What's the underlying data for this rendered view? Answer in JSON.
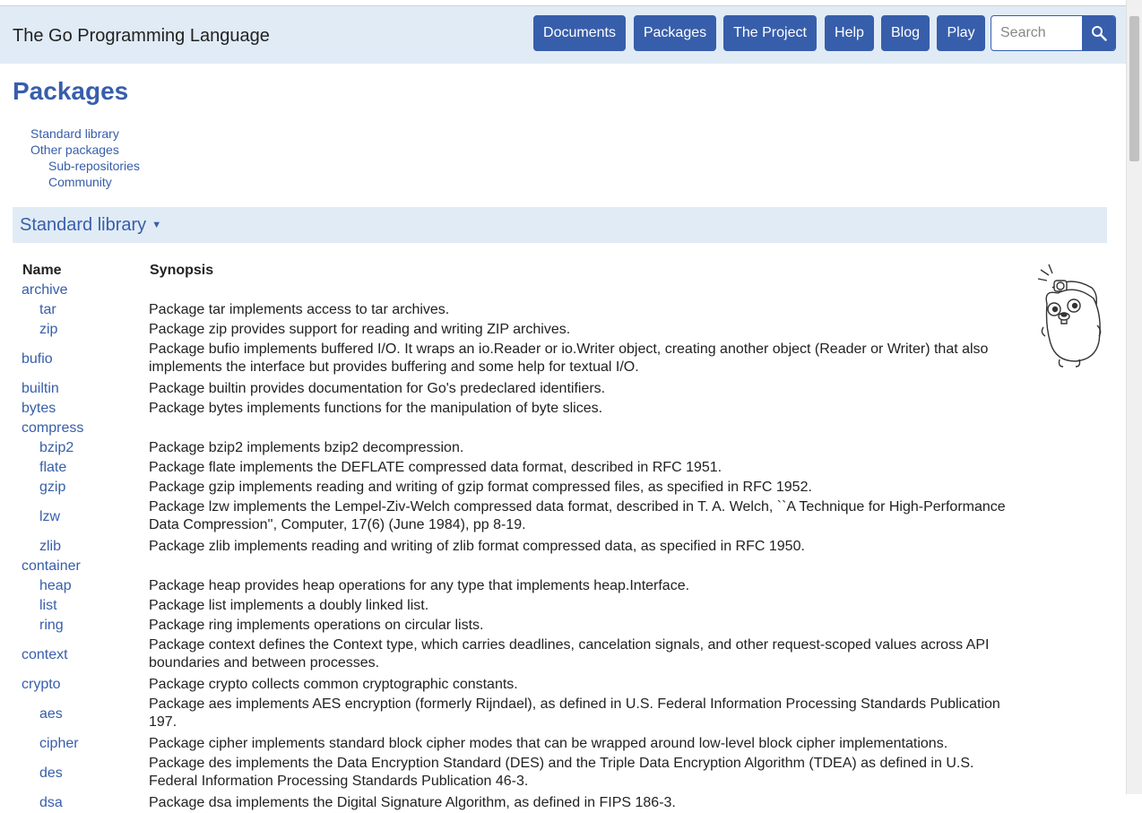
{
  "header": {
    "site_title": "The Go Programming Language",
    "nav": [
      "Documents",
      "Packages",
      "The Project",
      "Help",
      "Blog",
      "Play"
    ],
    "search_placeholder": "Search"
  },
  "page": {
    "title": "Packages",
    "toc": {
      "standard_library": "Standard library",
      "other_packages": "Other packages",
      "sub_repositories": "Sub-repositories",
      "community": "Community"
    },
    "section_title": "Standard library",
    "columns": {
      "name": "Name",
      "synopsis": "Synopsis"
    }
  },
  "packages": [
    {
      "name": "archive",
      "sub": false,
      "desc": ""
    },
    {
      "name": "tar",
      "sub": true,
      "desc": "Package tar implements access to tar archives."
    },
    {
      "name": "zip",
      "sub": true,
      "desc": "Package zip provides support for reading and writing ZIP archives."
    },
    {
      "name": "bufio",
      "sub": false,
      "desc": "Package bufio implements buffered I/O. It wraps an io.Reader or io.Writer object, creating another object (Reader or Writer) that also implements the interface but provides buffering and some help for textual I/O.",
      "lines": 2
    },
    {
      "name": "builtin",
      "sub": false,
      "desc": "Package builtin provides documentation for Go's predeclared identifiers."
    },
    {
      "name": "bytes",
      "sub": false,
      "desc": "Package bytes implements functions for the manipulation of byte slices."
    },
    {
      "name": "compress",
      "sub": false,
      "desc": ""
    },
    {
      "name": "bzip2",
      "sub": true,
      "desc": "Package bzip2 implements bzip2 decompression."
    },
    {
      "name": "flate",
      "sub": true,
      "desc": "Package flate implements the DEFLATE compressed data format, described in RFC 1951."
    },
    {
      "name": "gzip",
      "sub": true,
      "desc": "Package gzip implements reading and writing of gzip format compressed files, as specified in RFC 1952."
    },
    {
      "name": "lzw",
      "sub": true,
      "desc": "Package lzw implements the Lempel-Ziv-Welch compressed data format, described in T. A. Welch, ``A Technique for High-Performance Data Compression'', Computer, 17(6) (June 1984), pp 8-19.",
      "lines": 2
    },
    {
      "name": "zlib",
      "sub": true,
      "desc": "Package zlib implements reading and writing of zlib format compressed data, as specified in RFC 1950."
    },
    {
      "name": "container",
      "sub": false,
      "desc": ""
    },
    {
      "name": "heap",
      "sub": true,
      "desc": "Package heap provides heap operations for any type that implements heap.Interface."
    },
    {
      "name": "list",
      "sub": true,
      "desc": "Package list implements a doubly linked list."
    },
    {
      "name": "ring",
      "sub": true,
      "desc": "Package ring implements operations on circular lists."
    },
    {
      "name": "context",
      "sub": false,
      "desc": "Package context defines the Context type, which carries deadlines, cancelation signals, and other request-scoped values across API boundaries and between processes.",
      "lines": 2
    },
    {
      "name": "crypto",
      "sub": false,
      "desc": "Package crypto collects common cryptographic constants."
    },
    {
      "name": "aes",
      "sub": true,
      "desc": "Package aes implements AES encryption (formerly Rijndael), as defined in U.S. Federal Information Processing Standards Publication 197.",
      "lines": 2
    },
    {
      "name": "cipher",
      "sub": true,
      "desc": "Package cipher implements standard block cipher modes that can be wrapped around low-level block cipher implementations."
    },
    {
      "name": "des",
      "sub": true,
      "desc": "Package des implements the Data Encryption Standard (DES) and the Triple Data Encryption Algorithm (TDEA) as defined in U.S. Federal Information Processing Standards Publication 46-3.",
      "lines": 2
    },
    {
      "name": "dsa",
      "sub": true,
      "desc": "Package dsa implements the Digital Signature Algorithm, as defined in FIPS 186-3."
    }
  ],
  "colors": {
    "brand_blue": "#375eab",
    "header_bg": "#e0ebf5"
  }
}
